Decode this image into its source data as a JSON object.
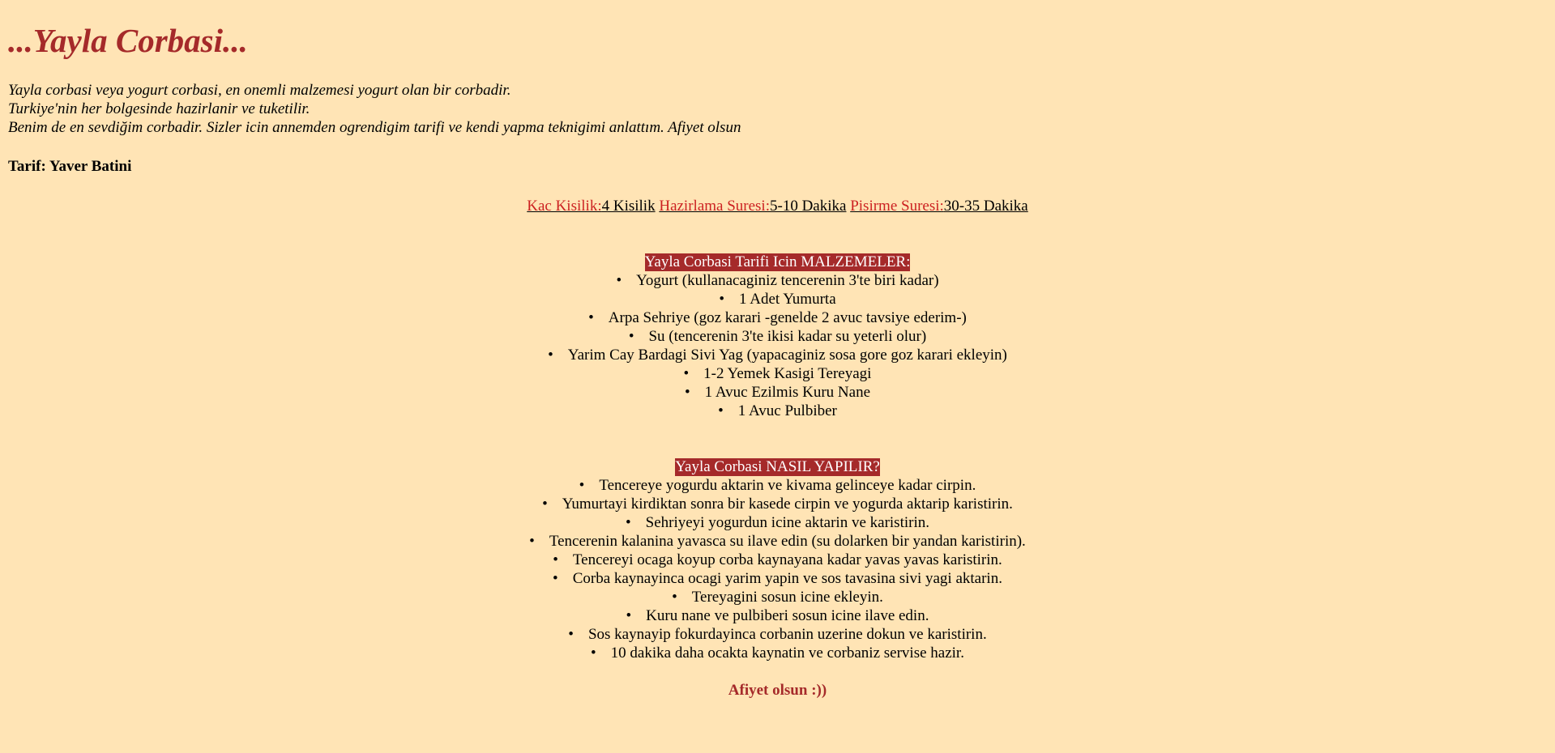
{
  "title": "...Yayla Corbasi...",
  "intro": [
    "Yayla corbasi veya yogurt corbasi, en onemli malzemesi yogurt olan bir corbadir.",
    "Turkiye'nin her bolgesinde hazirlanir ve tuketilir.",
    "Benim de en sevdiğim corbadir. Sizler icin annemden ogrendigim tarifi ve kendi yapma teknigimi anlattım. Afiyet olsun"
  ],
  "author": "Tarif: Yaver Batini",
  "meta": {
    "servings_label": "Kac Kisilik:",
    "servings_value": "4 Kisilik",
    "prep_label": "Hazirlama Suresi:",
    "prep_value": "5-10 Dakika",
    "cook_label": "Pisirme Suresi:",
    "cook_value": "30-35 Dakika"
  },
  "ingredients": {
    "heading": "Yayla Corbasi Tarifi Icin MALZEMELER:",
    "items": [
      "Yogurt (kullanacaginiz tencerenin 3'te biri kadar)",
      "1 Adet Yumurta",
      "Arpa Sehriye (goz karari -genelde 2 avuc tavsiye ederim-)",
      "Su (tencerenin 3'te ikisi kadar su yeterli olur)",
      "Yarim Cay Bardagi Sivi Yag (yapacaginiz sosa gore goz karari ekleyin)",
      "1-2 Yemek Kasigi Tereyagi",
      "1 Avuc Ezilmis Kuru Nane",
      "1 Avuc Pulbiber"
    ]
  },
  "steps": {
    "heading": "Yayla Corbasi NASIL YAPILIR?",
    "items": [
      "Tencereye yogurdu aktarin ve kivama gelinceye kadar cirpin.",
      "Yumurtayi kirdiktan sonra bir kasede cirpin ve yogurda aktarip karistirin.",
      "Sehriyeyi yogurdun icine aktarin ve karistirin.",
      "Tencerenin kalanina yavasca su ilave edin (su dolarken bir yandan karistirin).",
      "Tencereyi ocaga koyup corba kaynayana kadar yavas yavas karistirin.",
      "Corba kaynayinca ocagi yarim yapin ve sos tavasina sivi yagi aktarin.",
      "Tereyagini sosun icine ekleyin.",
      "Kuru nane ve pulbiberi sosun icine ilave edin.",
      "Sos kaynayip fokurdayinca corbanin uzerine dokun ve karistirin.",
      "10 dakika daha ocakta kaynatin ve corbaniz servise hazir."
    ]
  },
  "closing": "Afiyet olsun :))",
  "colors": {
    "background": "#FFE4B5",
    "title": "#A52A2A",
    "label_red": "#CC2222",
    "heading_bg": "#A52A2A"
  }
}
